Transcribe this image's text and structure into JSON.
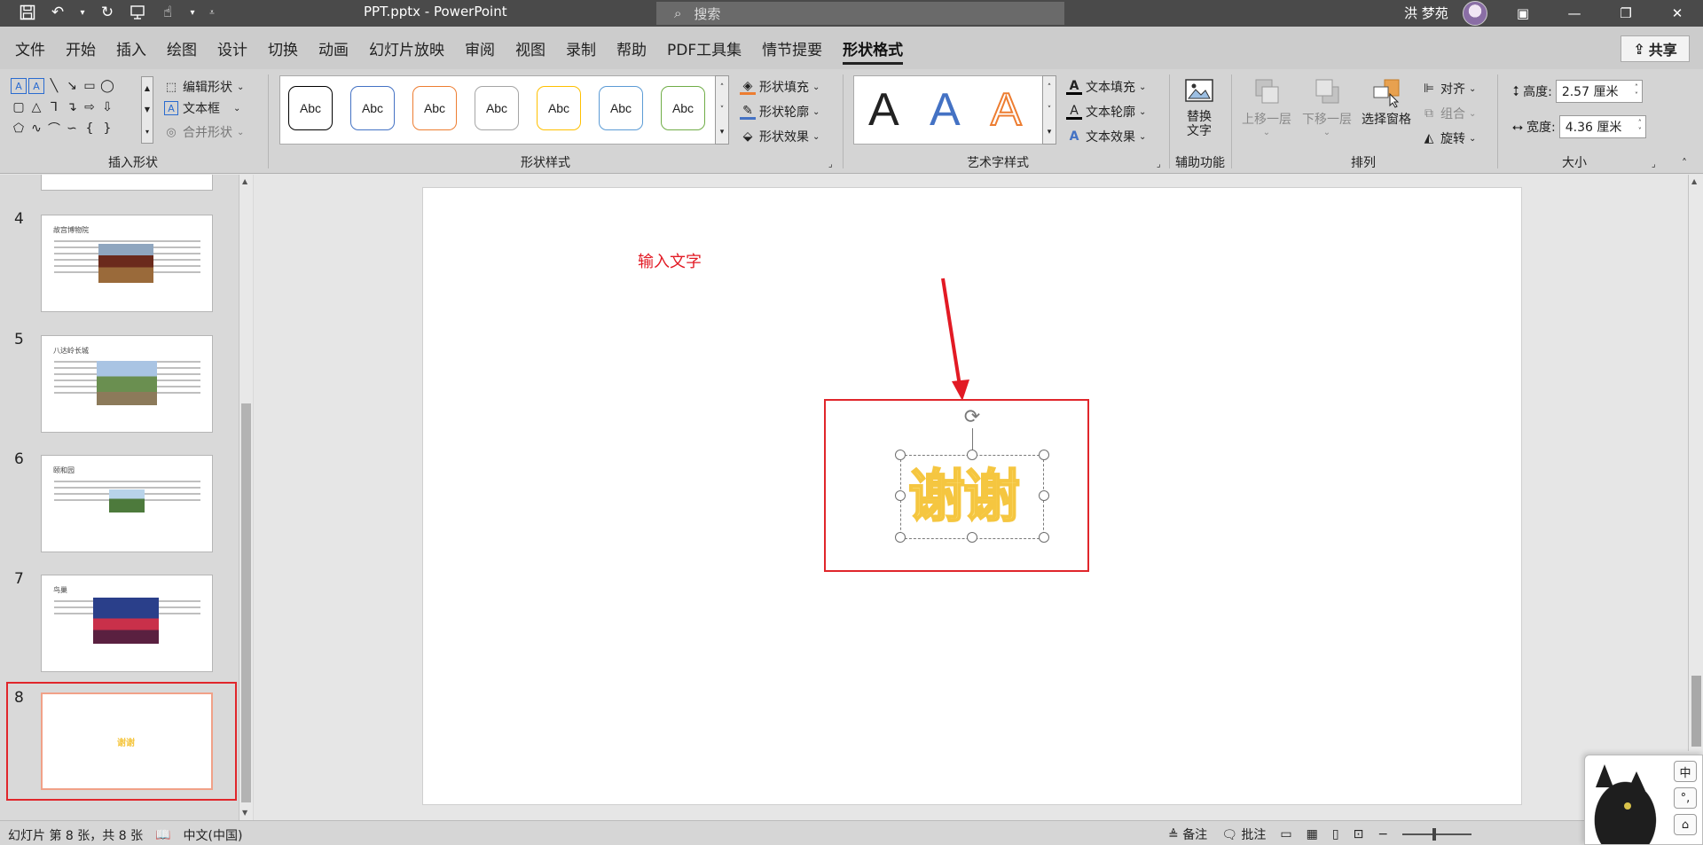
{
  "window": {
    "doc_title": "PPT.pptx  -  PowerPoint",
    "search_placeholder": "搜索",
    "user_name": "洪 梦苑"
  },
  "menu": {
    "tabs": [
      "文件",
      "开始",
      "插入",
      "绘图",
      "设计",
      "切换",
      "动画",
      "幻灯片放映",
      "审阅",
      "视图",
      "录制",
      "帮助",
      "PDF工具集",
      "情节提要",
      "形状格式"
    ],
    "active_tab": "形状格式",
    "share_label": "共享"
  },
  "ribbon": {
    "insert_shapes": {
      "label": "插入形状",
      "edit_shape": "编辑形状",
      "text_box": "文本框",
      "merge_shapes": "合并形状"
    },
    "shape_styles": {
      "label": "形状样式",
      "styles": [
        {
          "text": "Abc",
          "color": "#000000"
        },
        {
          "text": "Abc",
          "color": "#4472c4"
        },
        {
          "text": "Abc",
          "color": "#ed7d31"
        },
        {
          "text": "Abc",
          "color": "#a5a5a5"
        },
        {
          "text": "Abc",
          "color": "#ffc000"
        },
        {
          "text": "Abc",
          "color": "#5b9bd5"
        },
        {
          "text": "Abc",
          "color": "#70ad47"
        }
      ],
      "fill": "形状填充",
      "outline": "形状轮廓",
      "effects": "形状效果"
    },
    "wordart_styles": {
      "label": "艺术字样式",
      "samples": [
        {
          "text": "A",
          "color": "#000000"
        },
        {
          "text": "A",
          "color": "#4472c4"
        },
        {
          "text": "A",
          "color": "#ed7d31"
        }
      ],
      "text_fill": "文本填充",
      "text_outline": "文本轮廓",
      "text_effects": "文本效果"
    },
    "accessibility": {
      "label": "辅助功能",
      "alt_text": "替换\n文字"
    },
    "arrange": {
      "label": "排列",
      "bring_forward": "上移一层",
      "send_backward": "下移一层",
      "selection_pane": "选择窗格",
      "align": "对齐",
      "group": "组合",
      "rotate": "旋转"
    },
    "size": {
      "label": "大小",
      "height_label": "高度:",
      "height_value": "2.57 厘米",
      "width_label": "宽度:",
      "width_value": "4.36 厘米"
    }
  },
  "thumbnails": [
    {
      "num": "4",
      "title": "故宫博物院"
    },
    {
      "num": "5",
      "title": "八达岭长城"
    },
    {
      "num": "6",
      "title": "颐和园"
    },
    {
      "num": "7",
      "title": "鸟巢"
    },
    {
      "num": "8",
      "title": "",
      "selected": true
    }
  ],
  "canvas": {
    "annotation": "输入文字",
    "wordart": "谢谢",
    "annotation_color": "#e21a24"
  },
  "status": {
    "slide_info": "幻灯片 第 8 张，共 8 张",
    "language": "中文(中国)",
    "notes": "备注",
    "comments": "批注"
  },
  "ime": {
    "mode": "中",
    "punct": "°,"
  }
}
